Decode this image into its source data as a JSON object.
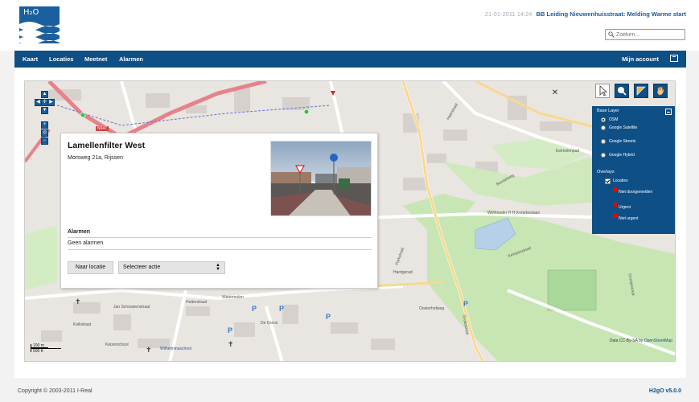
{
  "app": {
    "logo_text": "H₂O",
    "colors": {
      "brand": "#0e4f86",
      "accent": "#1f5a96",
      "alarm": "#ee0000",
      "park": "#c8e6b4",
      "water": "#b5d0e8"
    }
  },
  "header": {
    "ticker_date": "21-01-2011 14:24",
    "ticker_message": "BB Leiding Nieuwenhuisstraat:  Melding Warme start",
    "search_placeholder": "Zoeken..."
  },
  "nav": {
    "items": [
      "Kaart",
      "Locaties",
      "Meetnet",
      "Alarmen"
    ],
    "account": "Mijn account"
  },
  "map": {
    "road_labels": [
      "N347",
      "Wethouder H H Kortebosiaan",
      "Parkstraat",
      "Haarstraat",
      "Eelmolenpad",
      "Hardgerad",
      "Oosterhofweg",
      "Watermolen",
      "Hutterstraat",
      "De Grens",
      "Kolkstraat",
      "Jan Schouwenstraat",
      "Keizerschool",
      "Wilhelminaschool",
      "Borstelweg",
      "Oranjestraat",
      "Kempendreef",
      "Grotestraat"
    ],
    "tools": [
      "pointer-icon",
      "zoom-icon",
      "ruler-icon",
      "pan-hand-icon"
    ],
    "layers": {
      "title": "Base Layer",
      "base": [
        {
          "label": "OSM",
          "selected": true
        },
        {
          "label": "Google Satellite",
          "selected": false
        },
        {
          "label": "Google Streets",
          "selected": false
        },
        {
          "label": "Google Hybrid",
          "selected": false
        }
      ],
      "overlay_title": "Overlays",
      "overlay": {
        "label": "Locaties",
        "checked": true
      },
      "legend": [
        "Niet doorgemelden",
        "Urgent",
        "Niet urgent"
      ]
    },
    "scale_top": "100 m",
    "scale_bottom": "500 ft",
    "attribution_prefix": "Data CC-By-SA by ",
    "attribution_link": "OpenStreetMap"
  },
  "popup": {
    "title": "Lamellenfilter West",
    "address": "Morsweg 21a, Rijssen",
    "alarms_heading": "Alarmen",
    "alarms_value": "Geen alarmen",
    "button": "Naar locatie",
    "select_value": "Selecteer actie"
  },
  "footer": {
    "copyright": "Copyright  ©  2003-2011  I-Real",
    "version": "H2gO v5.0.0"
  }
}
